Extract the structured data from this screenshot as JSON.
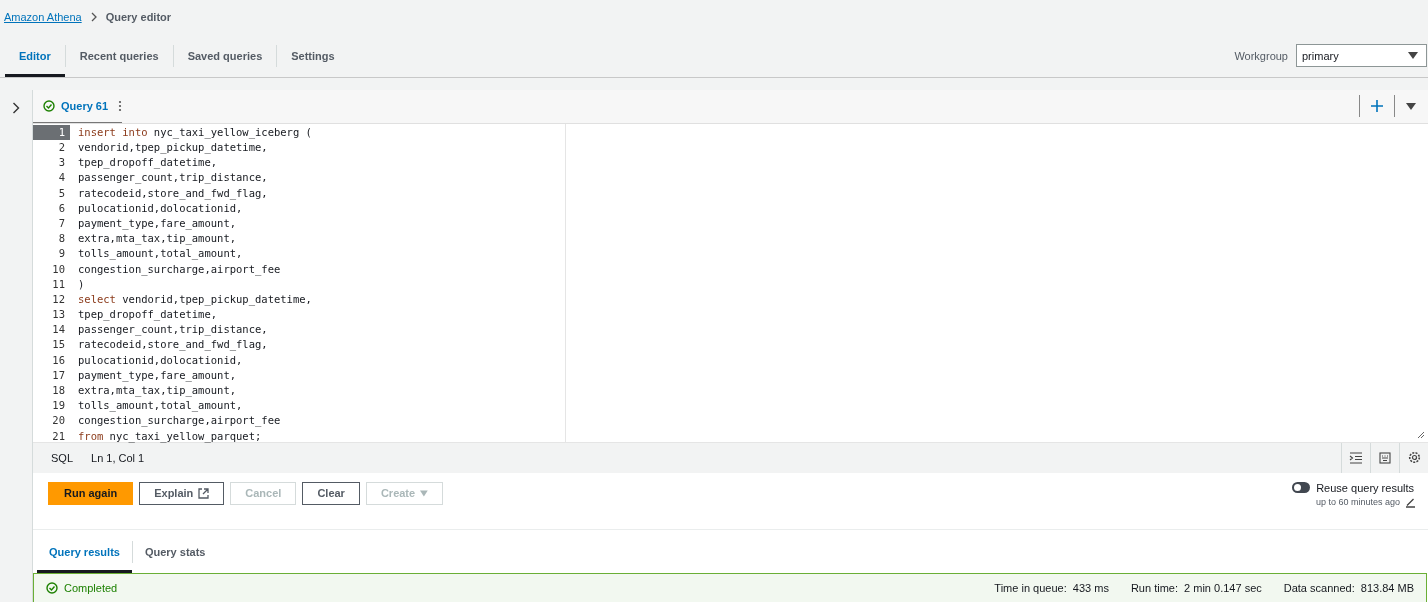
{
  "breadcrumb": {
    "link": "Amazon Athena",
    "current": "Query editor"
  },
  "tabs": [
    {
      "label": "Editor",
      "selected": true
    },
    {
      "label": "Recent queries",
      "selected": false
    },
    {
      "label": "Saved queries",
      "selected": false
    },
    {
      "label": "Settings",
      "selected": false
    }
  ],
  "workgroup": {
    "label": "Workgroup",
    "value": "primary"
  },
  "query_tab": {
    "label": "Query 61",
    "done": true
  },
  "code_lines": [
    {
      "number": "1",
      "keyword": "insert into",
      "rest": " nyc_taxi_yellow_iceberg (",
      "current": true
    },
    {
      "number": "2",
      "rest": "vendorid,tpep_pickup_datetime,",
      "current": false
    },
    {
      "number": "3",
      "rest": "tpep_dropoff_datetime,",
      "current": false
    },
    {
      "number": "4",
      "rest": "passenger_count,trip_distance,",
      "current": false
    },
    {
      "number": "5",
      "rest": "ratecodeid,store_and_fwd_flag,",
      "current": false
    },
    {
      "number": "6",
      "rest": "pulocationid,dolocationid,",
      "current": false
    },
    {
      "number": "7",
      "rest": "payment_type,fare_amount,",
      "current": false
    },
    {
      "number": "8",
      "rest": "extra,mta_tax,tip_amount,",
      "current": false
    },
    {
      "number": "9",
      "rest": "tolls_amount,total_amount,",
      "current": false
    },
    {
      "number": "10",
      "rest": "congestion_surcharge,airport_fee",
      "current": false
    },
    {
      "number": "11",
      "rest": ")",
      "current": false
    },
    {
      "number": "12",
      "keyword": "select",
      "rest": " vendorid,tpep_pickup_datetime,",
      "current": false
    },
    {
      "number": "13",
      "rest": "tpep_dropoff_datetime,",
      "current": false
    },
    {
      "number": "14",
      "rest": "passenger_count,trip_distance,",
      "current": false
    },
    {
      "number": "15",
      "rest": "ratecodeid,store_and_fwd_flag,",
      "current": false
    },
    {
      "number": "16",
      "rest": "pulocationid,dolocationid,",
      "current": false
    },
    {
      "number": "17",
      "rest": "payment_type,fare_amount,",
      "current": false
    },
    {
      "number": "18",
      "rest": "extra,mta_tax,tip_amount,",
      "current": false
    },
    {
      "number": "19",
      "rest": "tolls_amount,total_amount,",
      "current": false
    },
    {
      "number": "20",
      "rest": "congestion_surcharge,airport_fee",
      "current": false
    },
    {
      "number": "21",
      "keyword": "from",
      "rest": " nyc_taxi_yellow_parquet;",
      "current": false
    }
  ],
  "status_bar": {
    "language": "SQL",
    "position": "Ln 1, Col 1"
  },
  "buttons": [
    {
      "label": "Run again",
      "kind": "primary",
      "disabled": false
    },
    {
      "label": "Explain",
      "kind": "external",
      "disabled": false
    },
    {
      "label": "Cancel",
      "kind": "normal",
      "disabled": true
    },
    {
      "label": "Clear",
      "kind": "normal",
      "disabled": false
    },
    {
      "label": "Create",
      "kind": "dropdown",
      "disabled": true
    }
  ],
  "reuse": {
    "label": "Reuse query results",
    "on": false,
    "note": "up to 60 minutes ago"
  },
  "result_tabs": [
    {
      "label": "Query results",
      "selected": true
    },
    {
      "label": "Query stats",
      "selected": false
    }
  ],
  "result": {
    "status": "Completed",
    "stats": [
      {
        "label": "Time in queue:",
        "value": "433 ms"
      },
      {
        "label": "Run time:",
        "value": "2 min 0.147 sec"
      },
      {
        "label": "Data scanned:",
        "value": "813.84 MB"
      }
    ]
  }
}
